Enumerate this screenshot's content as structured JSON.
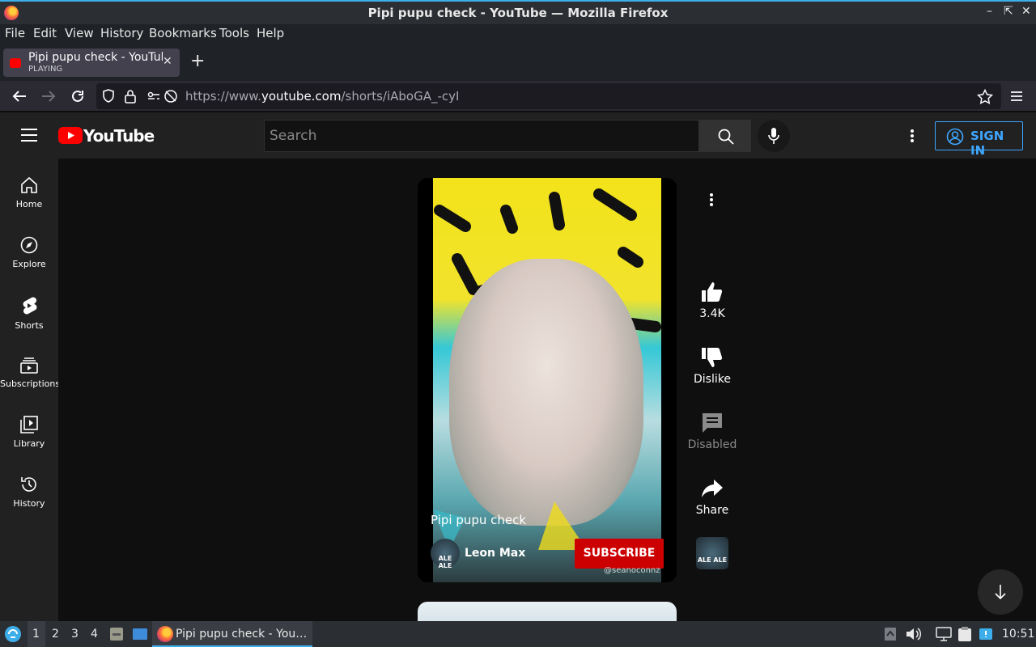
{
  "window": {
    "title": "Pipi pupu check - YouTube — Mozilla Firefox"
  },
  "menubar": {
    "items": [
      "File",
      "Edit",
      "View",
      "History",
      "Bookmarks",
      "Tools",
      "Help"
    ]
  },
  "tab": {
    "title": "Pipi pupu check - YouTube",
    "status": "PLAYING"
  },
  "navbar": {
    "url_prefix": "https://www.",
    "url_domain": "youtube.com",
    "url_path": "/shorts/iAboGA_-cyI"
  },
  "youtube": {
    "logo_text": "YouTube",
    "search_placeholder": "Search",
    "sign_in_label": "SIGN IN",
    "sidebar": [
      {
        "label": "Home",
        "icon": "home-icon"
      },
      {
        "label": "Explore",
        "icon": "compass-icon"
      },
      {
        "label": "Shorts",
        "icon": "shorts-icon"
      },
      {
        "label": "Subscriptions",
        "icon": "subscriptions-icon"
      },
      {
        "label": "Library",
        "icon": "library-icon"
      },
      {
        "label": "History",
        "icon": "history-icon"
      }
    ],
    "short": {
      "title": "Pipi pupu check",
      "channel": "Leon Max",
      "subscribe_label": "SUBSCRIBE",
      "watermark": "@seanoconnz",
      "avatar_text": "ALE ALE"
    },
    "actions": {
      "like_count": "3.4K",
      "dislike_label": "Dislike",
      "comments_label": "Disabled",
      "share_label": "Share"
    }
  },
  "taskbar": {
    "desktops": [
      "1",
      "2",
      "3",
      "4"
    ],
    "active_window": "Pipi pupu check - You…",
    "clock": "10:51"
  },
  "colors": {
    "accent_blue": "#3ea6ff",
    "subscribe_red": "#cc0000",
    "yt_red": "#ff0000"
  }
}
